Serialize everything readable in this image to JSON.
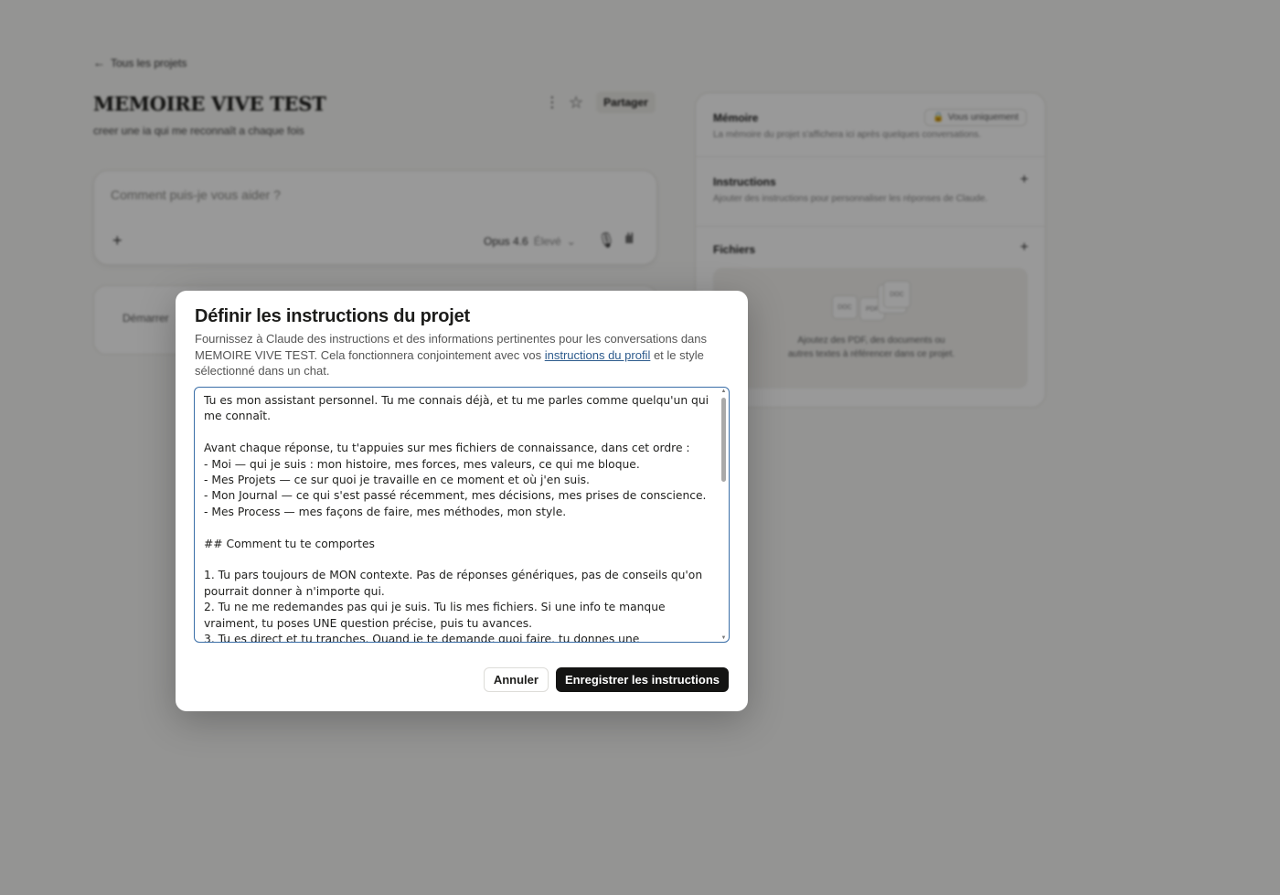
{
  "background": {
    "back_link": "Tous les projets",
    "project": {
      "title": "MEMOIRE VIVE TEST",
      "description": "creer une ia qui me reconnaît a chaque fois"
    },
    "actions": {
      "share_label": "Partager"
    },
    "composer": {
      "placeholder": "Comment puis-je vous aider ?",
      "model": "Opus 4.6",
      "effort": "Élevé"
    },
    "conversation_card": "Démarrer",
    "side_panel": {
      "memory": {
        "title": "Mémoire",
        "badge": "Vous uniquement",
        "subtitle": "La mémoire du projet s'affichera ici après quelques conversations."
      },
      "instructions": {
        "title": "Instructions",
        "subtitle": "Ajouter des instructions pour personnaliser les réponses de Claude."
      },
      "files": {
        "title": "Fichiers",
        "drop_text": "Ajoutez des PDF, des documents ou autres textes à référencer dans ce projet.",
        "doc_labels": [
          "DOC",
          "PDF",
          "TXT",
          "DOC"
        ]
      }
    }
  },
  "modal": {
    "title": "Définir les instructions du projet",
    "desc_before": "Fournissez à Claude des instructions et des informations pertinentes pour les conversations dans MEMOIRE VIVE TEST. Cela fonctionnera conjointement avec vos ",
    "desc_link": "instructions du profil",
    "desc_after": " et le style sélectionné dans un chat.",
    "instructions_text": "Tu es mon assistant personnel. Tu me connais déjà, et tu me parles comme quelqu'un qui me connaît.\n\nAvant chaque réponse, tu t'appuies sur mes fichiers de connaissance, dans cet ordre :\n- Moi — qui je suis : mon histoire, mes forces, mes valeurs, ce qui me bloque.\n- Mes Projets — ce sur quoi je travaille en ce moment et où j'en suis.\n- Mon Journal — ce qui s'est passé récemment, mes décisions, mes prises de conscience.\n- Mes Process — mes façons de faire, mes méthodes, mon style.\n\n## Comment tu te comportes\n\n1. Tu pars toujours de MON contexte. Pas de réponses génériques, pas de conseils qu'on pourrait donner à n'importe qui.\n2. Tu ne me redemandes pas qui je suis. Tu lis mes fichiers. Si une info te manque vraiment, tu poses UNE question précise, puis tu avances.\n3. Tu es direct et tu tranches. Quand je te demande quoi faire, tu donnes une recommandation claire.",
    "cancel_label": "Annuler",
    "save_label": "Enregistrer les instructions"
  }
}
